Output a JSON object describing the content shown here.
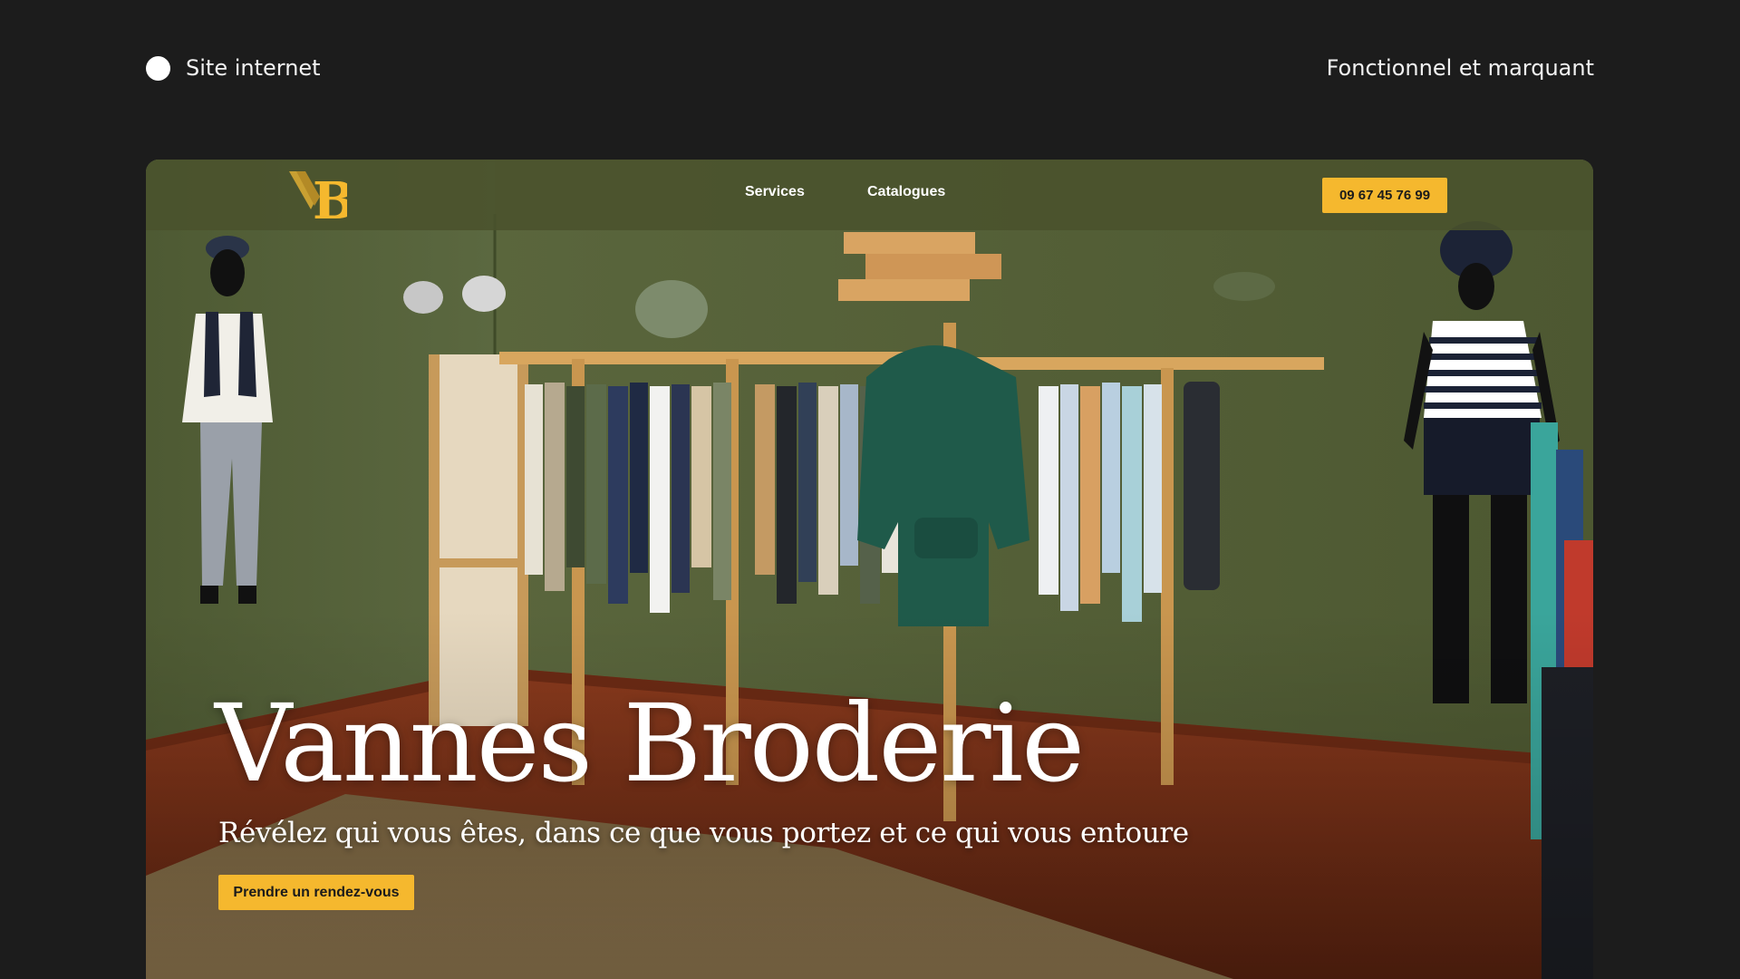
{
  "header": {
    "label": "Site internet",
    "tagline": "Fonctionnel et marquant"
  },
  "website": {
    "nav": {
      "links": [
        "Services",
        "Catalogues"
      ],
      "phone": "09 67 45 76 99"
    },
    "hero": {
      "title": "Vannes Broderie",
      "subtitle": "Révélez qui vous êtes, dans ce que vous portez et ce qui vous entoure",
      "cta_label": "Prendre un rendez-vous"
    },
    "logo_icon": "vb-monogram-icon"
  },
  "colors": {
    "page_background": "#1c1c1c",
    "accent": "#f5b82e",
    "navbar": "#4a522c",
    "wall": "#55613a",
    "floor": "#7a2e18"
  }
}
